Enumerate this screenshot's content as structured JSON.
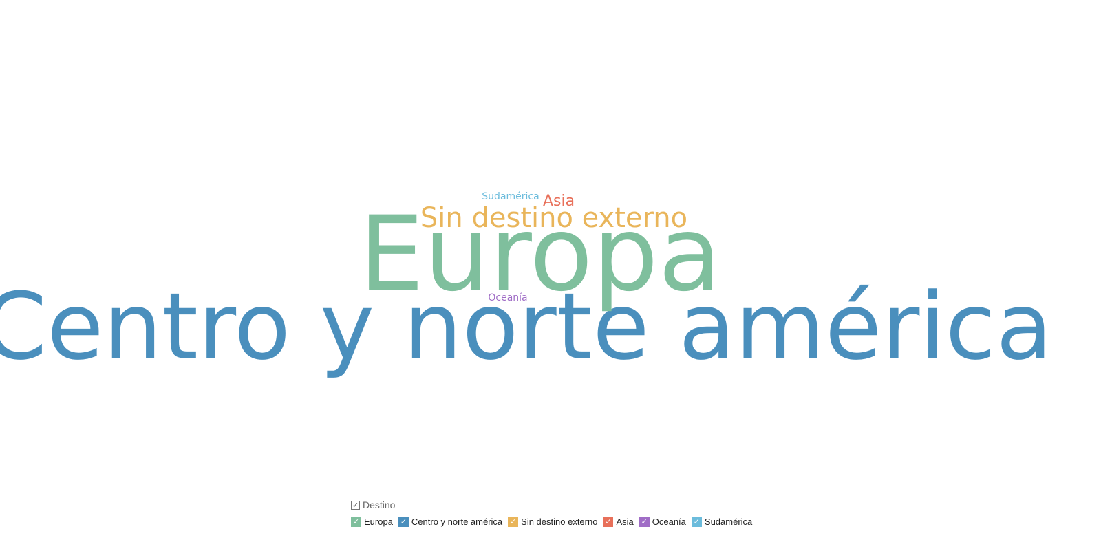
{
  "chart_data": {
    "type": "wordcloud",
    "legend_title": "Destino",
    "legend_placement": "bottom",
    "words": [
      {
        "text": "Centro y norte américa",
        "category": "Centro y norte américa",
        "color": "#4a8fbd",
        "rank": 1
      },
      {
        "text": "Europa",
        "category": "Europa",
        "color": "#7fbf9d",
        "rank": 2
      },
      {
        "text": "Sin destino externo",
        "category": "Sin destino externo",
        "color": "#e9b55a",
        "rank": 3
      },
      {
        "text": "Asia",
        "category": "Asia",
        "color": "#e8705a",
        "rank": 4
      },
      {
        "text": "Sudamérica",
        "category": "Sudamérica",
        "color": "#6cbcdc",
        "rank": 5
      },
      {
        "text": "Oceanía",
        "category": "Oceanía",
        "color": "#a06dc6",
        "rank": 6
      }
    ],
    "legend": [
      {
        "label": "Europa",
        "color": "#7fbf9d"
      },
      {
        "label": "Centro y norte américa",
        "color": "#4a8fbd"
      },
      {
        "label": "Sin destino externo",
        "color": "#e9b55a"
      },
      {
        "label": "Asia",
        "color": "#e8705a"
      },
      {
        "label": "Oceanía",
        "color": "#a06dc6"
      },
      {
        "label": "Sudamérica",
        "color": "#6cbcdc"
      }
    ],
    "check_glyph": "✓"
  }
}
